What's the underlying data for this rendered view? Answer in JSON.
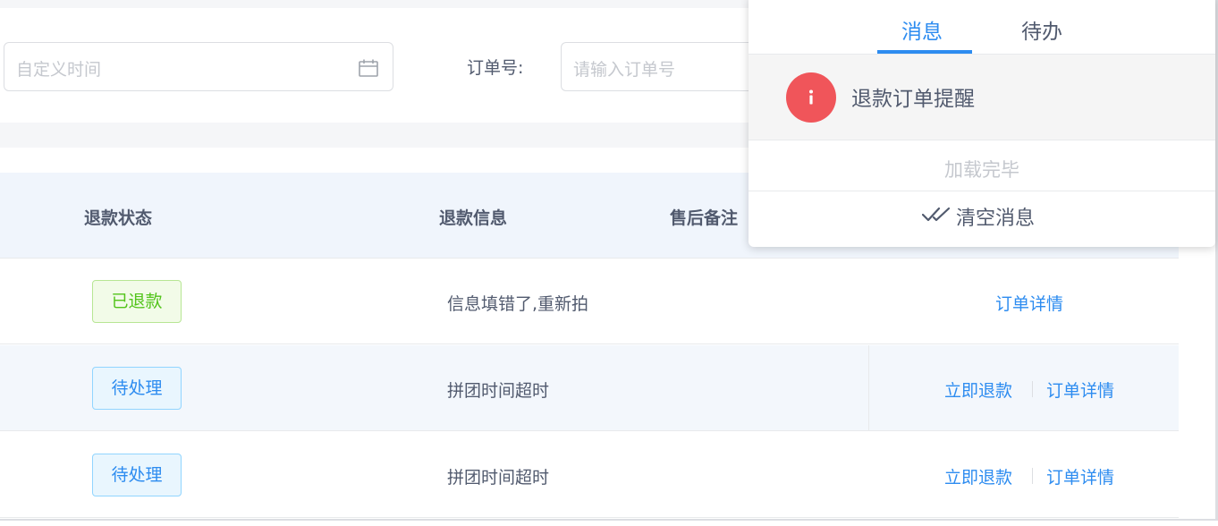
{
  "filters": {
    "date_placeholder": "自定义时间",
    "order_label": "订单号:",
    "order_placeholder": "请输入订单号"
  },
  "table": {
    "headers": [
      "退款状态",
      "退款信息",
      "售后备注"
    ],
    "rows": [
      {
        "status": "已退款",
        "status_color": "#52c41a",
        "info": "信息填错了,重新拍",
        "actions": [
          "订单详情"
        ]
      },
      {
        "status": "待处理",
        "status_color": "#2d8cf0",
        "info": "拼团时间超时",
        "actions": [
          "立即退款",
          "订单详情"
        ]
      },
      {
        "status": "待处理",
        "status_color": "#2d8cf0",
        "info": "拼团时间超时",
        "actions": [
          "立即退款",
          "订单详情"
        ]
      }
    ]
  },
  "notification": {
    "tabs": [
      {
        "label": "消息",
        "active": true
      },
      {
        "label": "待办",
        "active": false
      }
    ],
    "items": [
      {
        "icon": "info-icon",
        "title": "退款订单提醒",
        "badge_color": "#f0555a"
      }
    ],
    "loaded_text": "加载完毕",
    "clear_label": "清空消息"
  },
  "colors": {
    "accent": "#2d8cf0",
    "success": "#52c41a",
    "header_bg": "#f0f5fc"
  }
}
